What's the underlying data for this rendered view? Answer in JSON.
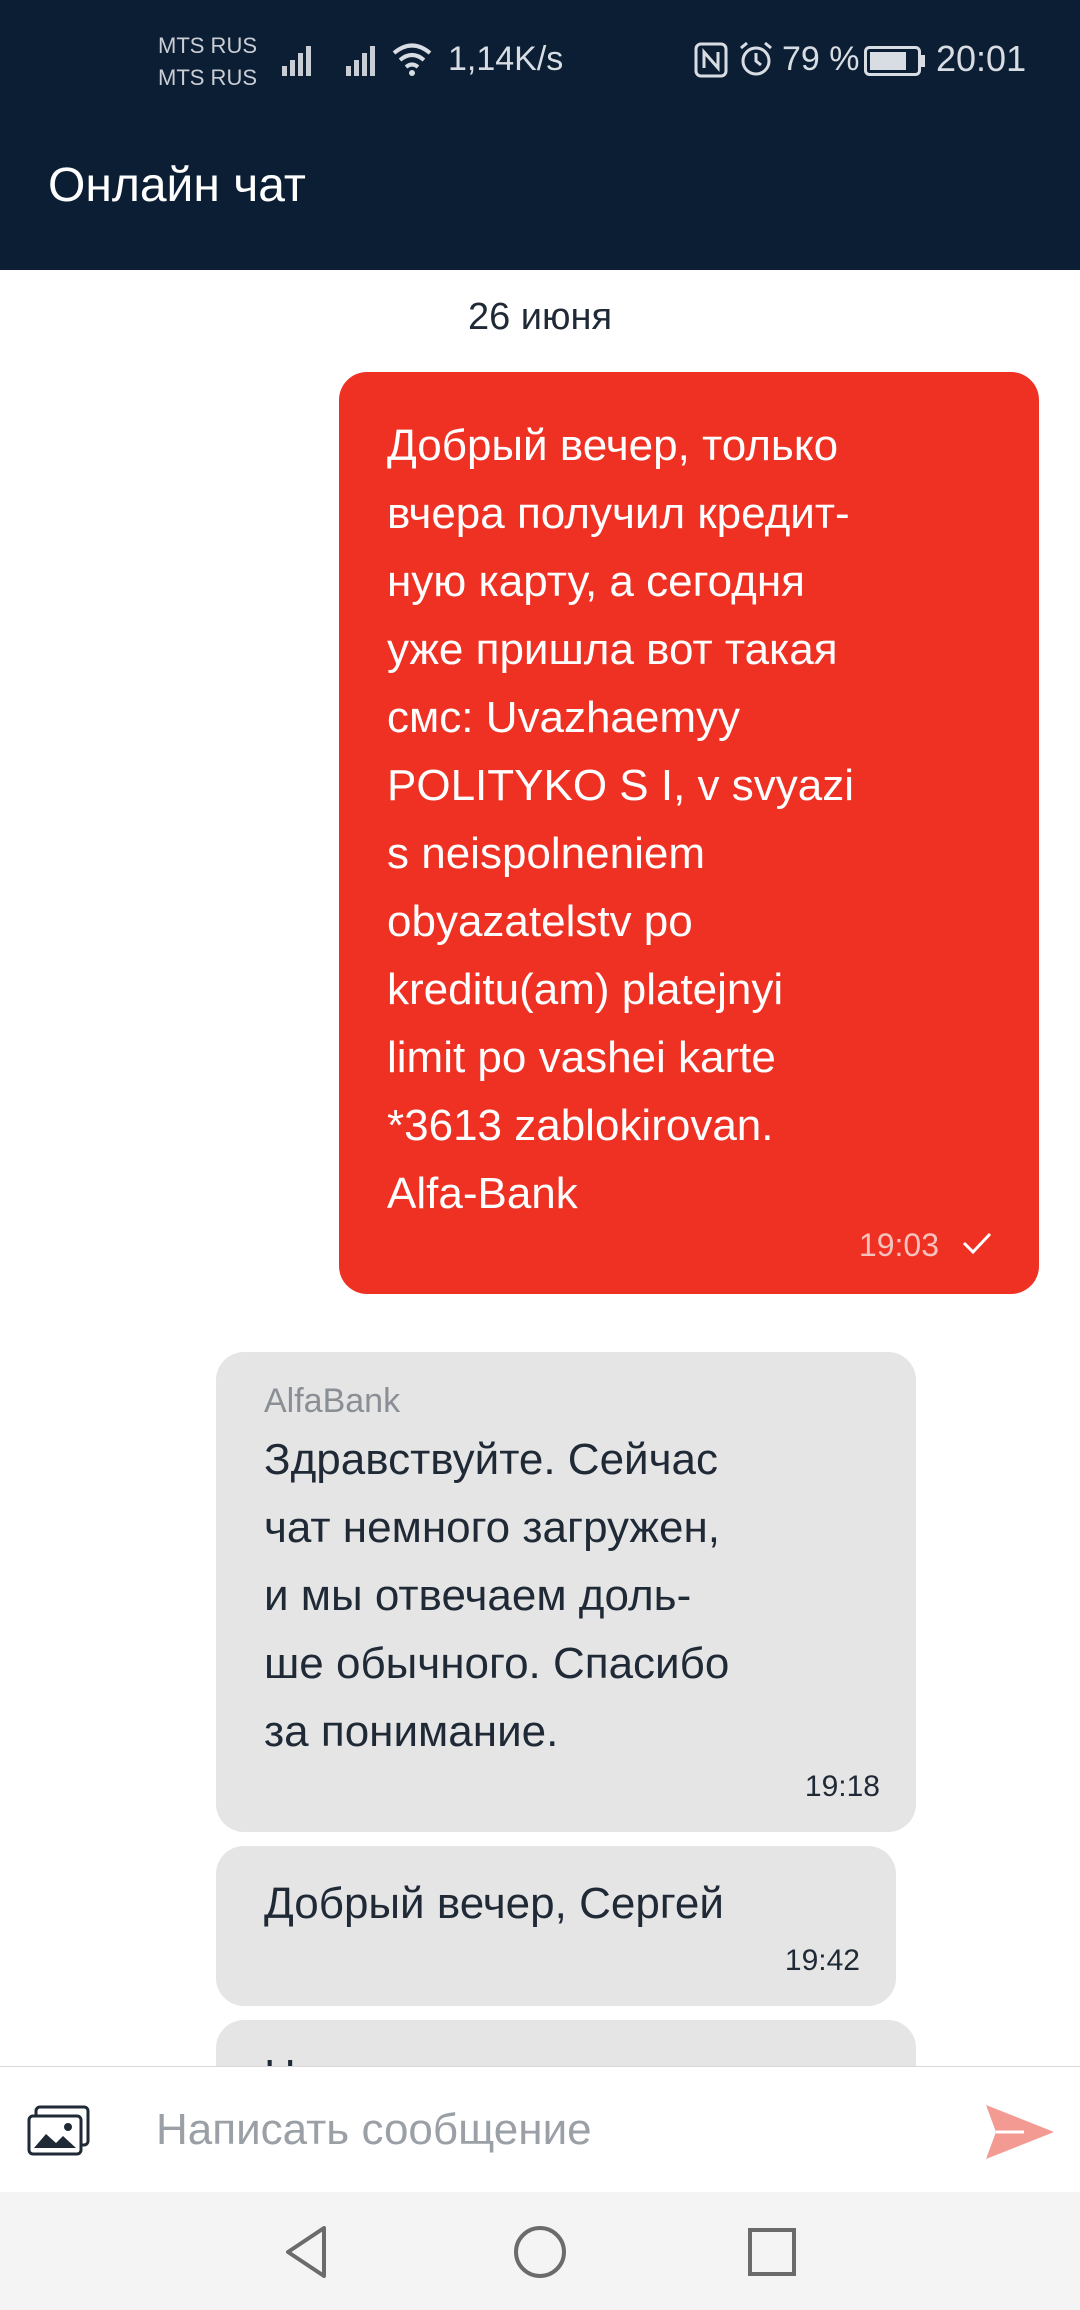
{
  "status_bar": {
    "carrier_1": "MTS RUS",
    "carrier_2": "MTS RUS",
    "network_speed": "1,14K/s",
    "battery_percent": "79 %",
    "time": "20:01",
    "icons": [
      "signal-icon",
      "signal-icon",
      "wifi-icon",
      "nfc-icon",
      "alarm-icon",
      "battery-icon"
    ]
  },
  "app_bar": {
    "title": "Онлайн чат"
  },
  "chat": {
    "date_separator": "26 июня",
    "messages": [
      {
        "direction": "outgoing",
        "text": "Добрый вечер, только\nвчера получил кредит-\nную карту, а сегодня\nуже пришла вот такая\nсмс: Uvazhaemyy\nPOLITYKO S I, v svyazi\ns neispolneniem\nobyazatelstv po\nkreditu(am) platejnyi\nlimit po vashei karte\n*3613 zablokirovan.\nAlfa-Bank",
        "time": "19:03",
        "status_icon": "check-icon"
      },
      {
        "direction": "incoming",
        "sender": "AlfaBank",
        "text": "Здравствуйте. Сейчас\nчат немного загружен,\nи мы отвечаем доль-\nше обычного. Спасибо\nза понимание.",
        "time": "19:18"
      },
      {
        "direction": "incoming",
        "text": "Добрый вечер, Сергей",
        "time": "19:42"
      },
      {
        "direction": "incoming",
        "text": "Н",
        "time": ""
      }
    ]
  },
  "input_bar": {
    "placeholder": "Написать сообщение",
    "attach_icon": "image-attach-icon",
    "send_icon": "send-icon"
  },
  "nav_bar": {
    "icons": [
      "back-icon",
      "home-icon",
      "recent-apps-icon"
    ]
  },
  "colors": {
    "header_bg": "#0c1e33",
    "outgoing_bubble": "#ef3124",
    "incoming_bubble": "#e5e5e5",
    "send_icon": "#f39a93"
  }
}
